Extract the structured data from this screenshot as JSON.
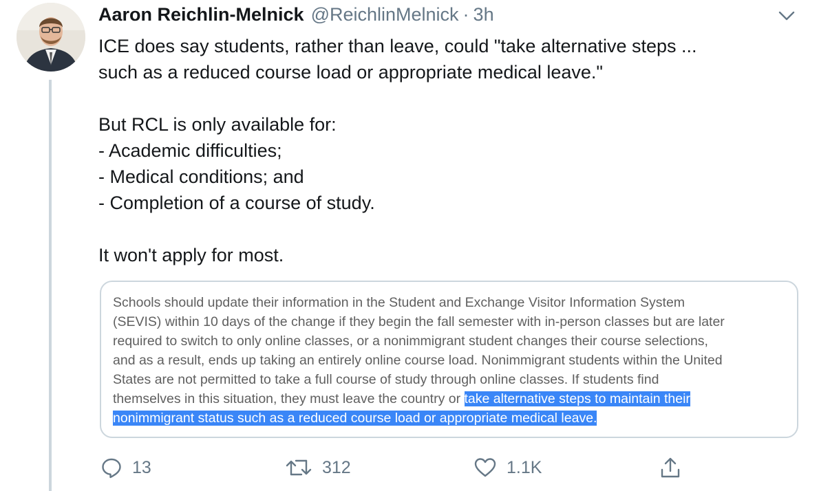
{
  "tweet": {
    "author_name": "Aaron Reichlin-Melnick",
    "handle": "@ReichlinMelnick",
    "separator": "·",
    "time": "3h",
    "text_lines": [
      "ICE does say students, rather than leave, could \"take alternative steps ...",
      "such as a reduced course load or appropriate medical leave.\"",
      "",
      "But RCL is only available for:",
      "- Academic difficulties;",
      "- Medical conditions; and",
      "- Completion of a course of study.",
      "",
      "It won't apply for most."
    ]
  },
  "quote": {
    "lines": [
      "Schools should update their information in the Student and Exchange Visitor Information System",
      "(SEVIS) within 10 days of the change if they begin the fall semester with in-person classes but are later",
      "required to switch to only online classes, or a nonimmigrant student changes their course selections,",
      "and as a result, ends up taking an entirely online course load. Nonimmigrant students within the United",
      "States are not permitted to take a full course of study through online classes. If students find"
    ],
    "line6_plain": "themselves in this situation, they must leave the country or ",
    "line6_highlight": "take alternative steps to maintain their",
    "line7_highlight": "nonimmigrant status such as a reduced course load or appropriate medical leave."
  },
  "actions": {
    "replies": "13",
    "retweets": "312",
    "likes": "1.1K"
  },
  "icons": {
    "reply": "reply-icon",
    "retweet": "retweet-icon",
    "like": "heart-icon",
    "share": "share-icon",
    "menu": "chevron-down-icon"
  },
  "colors": {
    "highlight": "#3a86f7",
    "muted": "#657786",
    "thread_line": "#ccd6dd"
  }
}
